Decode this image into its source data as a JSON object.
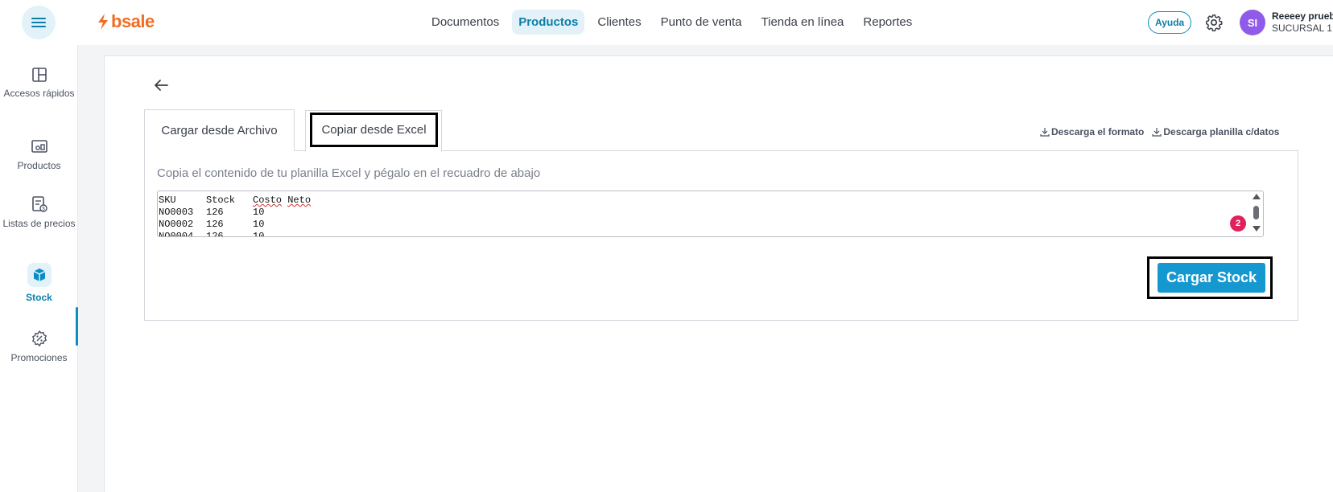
{
  "header": {
    "brand": "bsale",
    "nav": [
      "Documentos",
      "Productos",
      "Clientes",
      "Punto de venta",
      "Tienda en línea",
      "Reportes"
    ],
    "active_nav": "Productos",
    "help_label": "Ayuda",
    "avatar_initials": "SI",
    "user_name": "Reeeey prueb",
    "user_branch": "SUCURSAL 1"
  },
  "sidebar": {
    "items": [
      {
        "label": "Accesos rápidos",
        "icon": "layout-icon"
      },
      {
        "label": "Productos",
        "icon": "products-icon"
      },
      {
        "label": "Listas de precios",
        "icon": "price-list-icon"
      },
      {
        "label": "Stock",
        "icon": "box-icon",
        "active": true
      },
      {
        "label": "Promociones",
        "icon": "promotion-icon"
      }
    ]
  },
  "main": {
    "tabs": [
      {
        "label": "Cargar desde Archivo",
        "active": false
      },
      {
        "label": "Copiar desde Excel",
        "active": true
      }
    ],
    "downloads": [
      "Descarga el formato",
      "Descarga planilla c/datos"
    ],
    "instructions": "Copia el contenido de tu planilla Excel y pégalo en el recuadro de abajo",
    "textarea_lines": [
      {
        "c1": "SKU",
        "c2": "Stock",
        "c3a": "Costo",
        "c3b": "Neto"
      },
      {
        "c1": "NO0003",
        "c2": "126",
        "c3a": "10",
        "c3b": ""
      },
      {
        "c1": "NO0002",
        "c2": "126",
        "c3a": "10",
        "c3b": ""
      },
      {
        "c1": "NO0004",
        "c2": "126",
        "c3a": "10",
        "c3b": ""
      }
    ],
    "badge_count": "2",
    "load_button": "Cargar Stock"
  },
  "colors": {
    "brand": "#f26c22",
    "accent": "#0b8dc2",
    "button": "#1597cf",
    "badge": "#e0215b",
    "avatar": "#8f5be8"
  }
}
